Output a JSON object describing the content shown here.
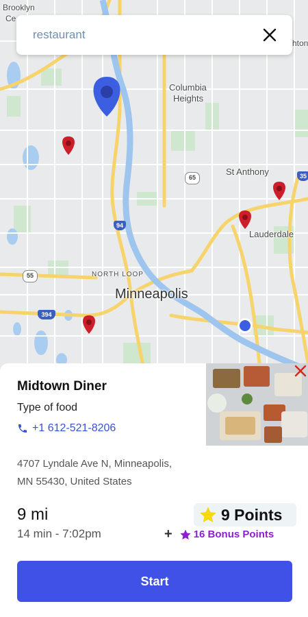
{
  "search": {
    "value": "restaurant",
    "close_icon": "close-icon"
  },
  "map": {
    "labels": {
      "brooklyn": "Brooklyn",
      "brooklyn_ce": "Ce",
      "columbia": "Columbia",
      "heights": "Heights",
      "st_anthony": "St Anthony",
      "lauderdale": "Lauderdale",
      "north_loop": "NORTH LOOP",
      "minneapolis": "Minneapolis",
      "hton": "hton"
    },
    "shields": {
      "i94": "94",
      "r65": "65",
      "r55": "55",
      "i394": "394",
      "i35": "35"
    }
  },
  "place": {
    "name": "Midtown Diner",
    "food_type": "Type of food",
    "phone": "+1 612-521-8206",
    "address_line1": "4707 Lyndale Ave N, Minneapolis,",
    "address_line2": "MN 55430, United States",
    "distance": "9 mi",
    "eta": "14 min - 7:02pm",
    "points": "9 Points",
    "bonus_plus": "+",
    "bonus": "16  Bonus Points"
  },
  "actions": {
    "start_label": "Start"
  },
  "colors": {
    "accent": "#3f51e6",
    "pin_red": "#cc1f2a",
    "pin_blue": "#3c5ee0",
    "bonus_purple": "#8e1fd1",
    "star_yellow": "#f5d90a"
  }
}
